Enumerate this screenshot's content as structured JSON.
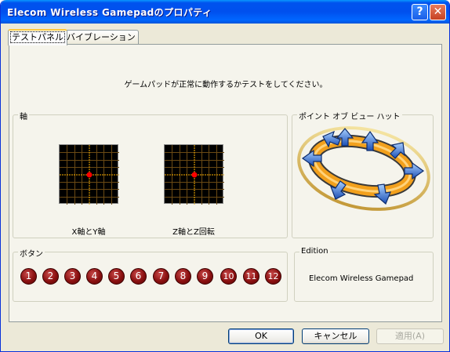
{
  "window": {
    "title": "Elecom Wireless Gamepadのプロパティ",
    "help_glyph": "?",
    "close_glyph": "✕"
  },
  "tabs": [
    {
      "label": "テストパネル",
      "active": true
    },
    {
      "label": "バイブレーション",
      "active": false
    }
  ],
  "instruction": "ゲームパッドが正常に動作するかテストをしてください。",
  "axes_group": {
    "label": "軸",
    "plots": [
      {
        "caption": "X軸とY軸"
      },
      {
        "caption": "Z軸とZ回転"
      }
    ]
  },
  "pov_group": {
    "label": "ポイント オブ ビュー ハット"
  },
  "buttons_group": {
    "label": "ボタン",
    "buttons": [
      "1",
      "2",
      "3",
      "4",
      "5",
      "6",
      "7",
      "8",
      "9",
      "10",
      "11",
      "12"
    ]
  },
  "edition_group": {
    "label": "Edition",
    "name": "Elecom Wireless Gamepad"
  },
  "dialog_buttons": {
    "ok": "OK",
    "cancel": "キャンセル",
    "apply": "適用(A)"
  },
  "colors": {
    "title_bar": "#0053ee",
    "plot_bg": "#000000",
    "plot_grid": "#6b4a14",
    "plot_cross": "#ffb400",
    "plot_dot": "#ff0000",
    "button_red": "#8a1010"
  }
}
